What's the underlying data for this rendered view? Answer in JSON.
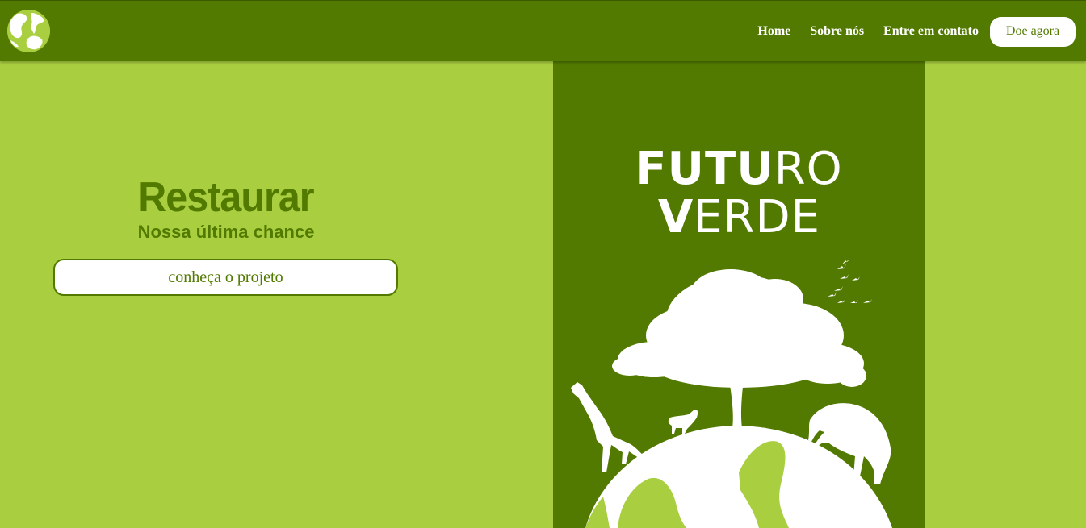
{
  "navbar": {
    "logo_icon": "globe-logo-icon",
    "links": [
      {
        "label": "Home"
      },
      {
        "label": "Sobre nós"
      },
      {
        "label": "Entre em contato"
      }
    ],
    "donate_label": "Doe agora"
  },
  "hero": {
    "title": "Restaurar",
    "subtitle": "Nossa última chance",
    "cta_label": "conheça o projeto"
  },
  "poster": {
    "title_parts": [
      "FUTU",
      "RO ",
      "V",
      "ERDE"
    ],
    "art_icon": "earth-tree-animals-silhouette-icon"
  },
  "colors": {
    "dark_green": "#527a00",
    "light_green": "#a9cf41",
    "white": "#ffffff"
  }
}
